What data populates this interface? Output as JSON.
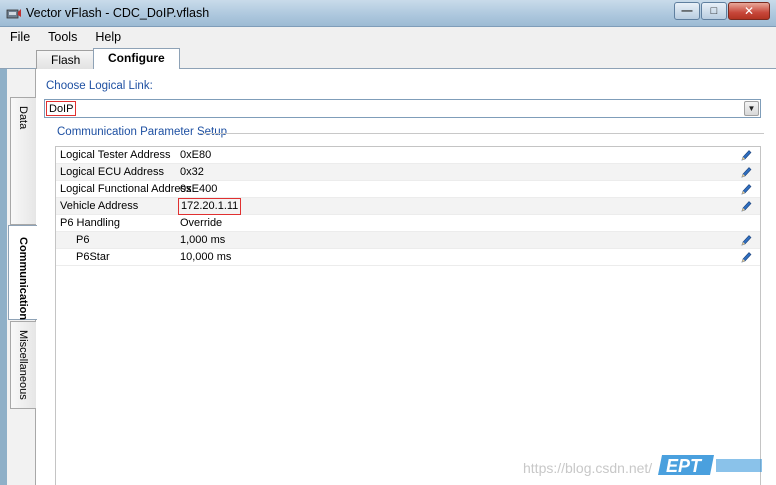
{
  "window": {
    "title": "Vector vFlash - CDC_DoIP.vflash",
    "minimize_glyph": "—",
    "maximize_glyph": "□",
    "close_glyph": "✕"
  },
  "menu": [
    "File",
    "Tools",
    "Help"
  ],
  "tabs": [
    {
      "label": "Flash",
      "active": false
    },
    {
      "label": "Configure",
      "active": true
    }
  ],
  "side_tabs": [
    {
      "label": "Data",
      "active": false
    },
    {
      "label": "Communication",
      "active": true
    },
    {
      "label": "Miscellaneous",
      "active": false
    }
  ],
  "logical_link": {
    "label": "Choose Logical Link:",
    "value": "DoIP"
  },
  "comm_setup": {
    "title": "Communication Parameter Setup",
    "rows": [
      {
        "name": "Logical Tester Address",
        "value": "0xE80",
        "editable": true
      },
      {
        "name": "Logical ECU Address",
        "value": "0x32",
        "editable": true
      },
      {
        "name": "Logical Functional Address",
        "value": "0xE400",
        "editable": true
      },
      {
        "name": "Vehicle Address",
        "value": "172.20.1.11",
        "editable": true,
        "highlighted": true
      },
      {
        "name": "P6 Handling",
        "value": "Override",
        "editable": false
      },
      {
        "name": "P6",
        "value": "1,000 ms",
        "editable": true,
        "indented": true
      },
      {
        "name": "P6Star",
        "value": "10,000 ms",
        "editable": true,
        "indented": true
      }
    ]
  },
  "watermark": {
    "url": "https://blog.csdn.net/",
    "logo_text": "EPT"
  },
  "colors": {
    "accent_blue": "#1e50a2",
    "highlight_red": "#e03030"
  }
}
